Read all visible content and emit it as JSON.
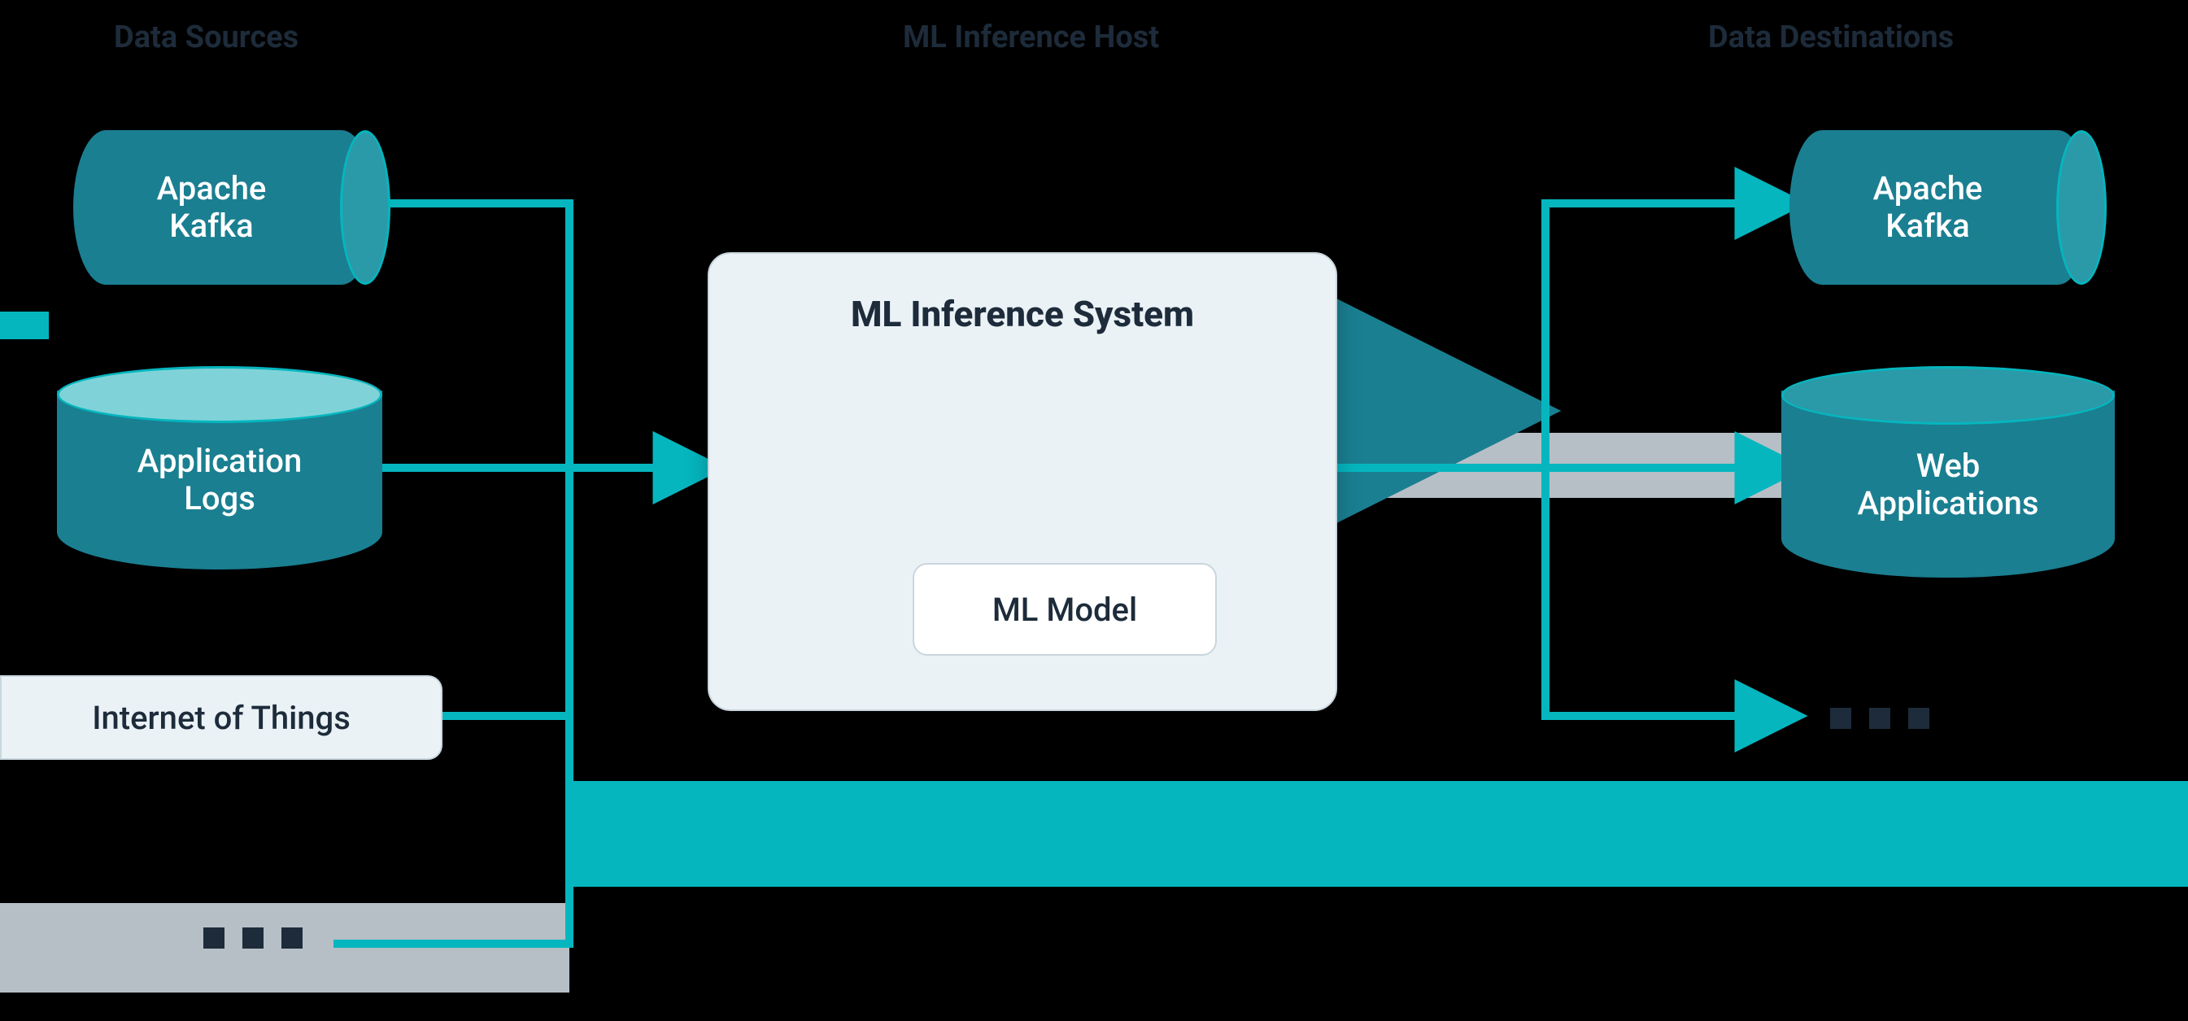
{
  "columns": {
    "sources_header": "Data Sources",
    "host_header": "ML Inference Host",
    "destinations_header": "Data Destinations"
  },
  "sources": {
    "kafka": "Apache\nKafka",
    "app_logs": "Application\nLogs",
    "iot": "Internet of Things"
  },
  "center": {
    "card_title": "ML Inference System",
    "model_label": "ML Model"
  },
  "destinations": {
    "kafka": "Apache\nKafka",
    "web_apps": "Web\nApplications"
  },
  "colors": {
    "dark": "#1d2b3a",
    "teal_dark": "#1a7f91",
    "teal_mid": "#2a9aa8",
    "teal_light": "#7fd3d8",
    "cyan": "#05b6bf",
    "card_bg": "#eaf2f6",
    "card_border": "#c9d6dd",
    "slab": "#b6bfc6"
  }
}
